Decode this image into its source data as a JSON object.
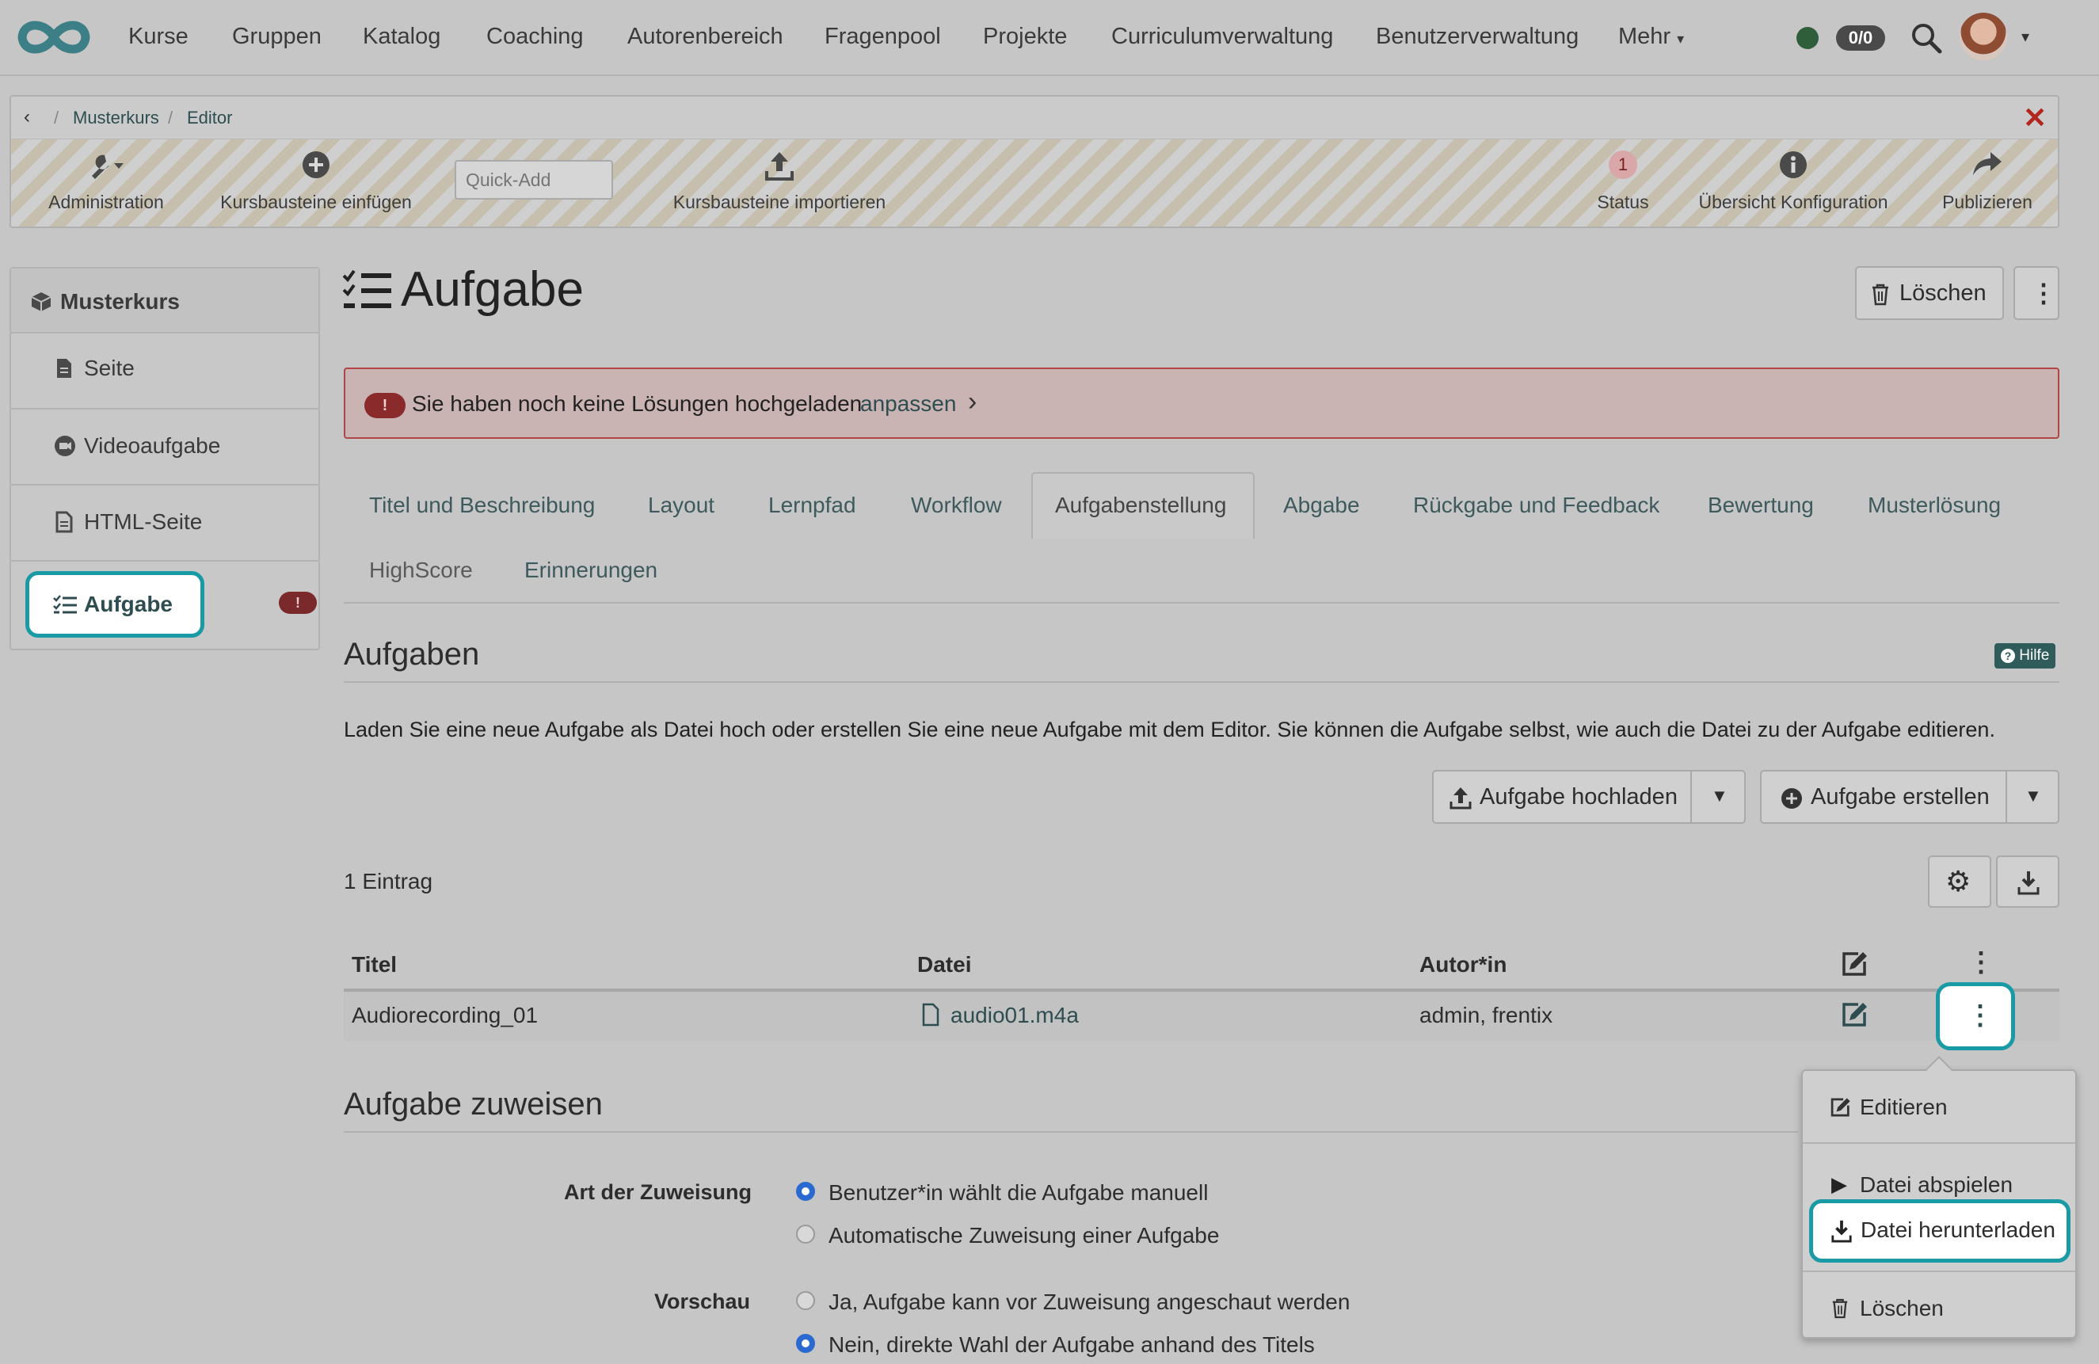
{
  "nav": {
    "items": [
      "Kurse",
      "Gruppen",
      "Katalog",
      "Coaching",
      "Autorenbereich",
      "Fragenpool",
      "Projekte",
      "Curriculumverwaltung",
      "Benutzerverwaltung",
      "Mehr"
    ],
    "badge": "0/0"
  },
  "breadcrumb": {
    "items": [
      "Musterkurs",
      "Editor"
    ]
  },
  "toolbar": {
    "administration": "Administration",
    "insert": "Kursbausteine einfügen",
    "quickadd_placeholder": "Quick-Add",
    "import": "Kursbausteine importieren",
    "status_count": "1",
    "status": "Status",
    "overview": "Übersicht Konfiguration",
    "publish": "Publizieren"
  },
  "sidebar": {
    "root": "Musterkurs",
    "items": [
      {
        "label": "Seite",
        "icon": "file-icon"
      },
      {
        "label": "Videoaufgabe",
        "icon": "video-icon"
      },
      {
        "label": "HTML-Seite",
        "icon": "html-file-icon"
      },
      {
        "label": "Aufgabe",
        "icon": "task-list-icon"
      }
    ]
  },
  "page": {
    "title": "Aufgabe",
    "delete_label": "Löschen",
    "alert_text": "Sie haben noch keine Lösungen hochgeladen",
    "alert_link": "anpassen"
  },
  "tabs": [
    "Titel und Beschreibung",
    "Layout",
    "Lernpfad",
    "Workflow",
    "Aufgabenstellung",
    "Abgabe",
    "Rückgabe und Feedback",
    "Bewertung",
    "Musterlösung",
    "HighScore",
    "Erinnerungen"
  ],
  "tasks": {
    "heading": "Aufgaben",
    "help_label": "Hilfe",
    "description": "Laden Sie eine neue Aufgabe als Datei hoch oder erstellen Sie eine neue Aufgabe mit dem Editor. Sie können die Aufgabe selbst, wie auch die Datei zu der Aufgabe editieren.",
    "upload_label": "Aufgabe hochladen",
    "create_label": "Aufgabe erstellen",
    "count_label": "1 Eintrag",
    "columns": [
      "Titel",
      "Datei",
      "Autor*in"
    ],
    "rows": [
      {
        "title": "Audiorecording_01",
        "file": "audio01.m4a",
        "author": "admin, frentix"
      }
    ]
  },
  "assign": {
    "heading": "Aufgabe zuweisen",
    "type_label": "Art der Zuweisung",
    "type_options": [
      "Benutzer*in wählt die Aufgabe manuell",
      "Automatische Zuweisung einer Aufgabe"
    ],
    "preview_label": "Vorschau",
    "preview_options": [
      "Ja, Aufgabe kann vor Zuweisung angeschaut werden",
      "Nein, direkte Wahl der Aufgabe anhand des Titels"
    ]
  },
  "context_menu": {
    "items": [
      "Editieren",
      "Datei abspielen",
      "Datei herunterladen",
      "Löschen"
    ]
  },
  "colors": {
    "accent": "#1a9aa5",
    "link": "#3e5a5c",
    "radio": "#2a69cf",
    "error": "#7a2a2a"
  }
}
